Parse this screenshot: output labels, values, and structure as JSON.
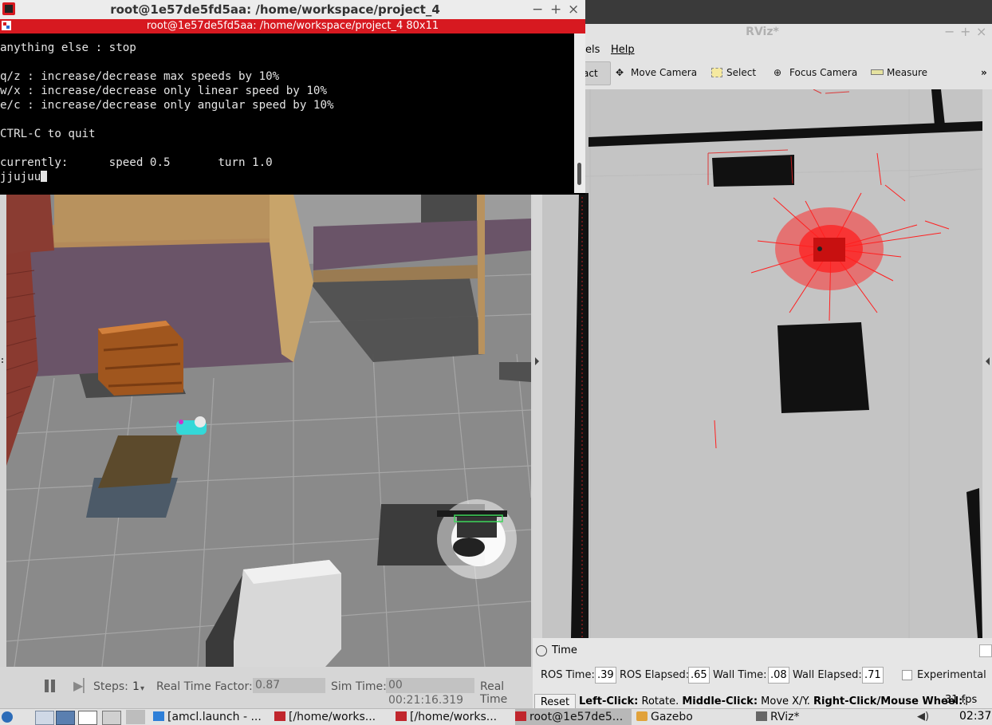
{
  "terminal": {
    "window_title": "root@1e57de5fd5aa: /home/workspace/project_4",
    "tab_title": "root@1e57de5fd5aa: /home/workspace/project_4 80x11",
    "lines": [
      "",
      "anything else : stop",
      "",
      "q/z : increase/decrease max speeds by 10%",
      "w/x : increase/decrease only linear speed by 10%",
      "e/c : increase/decrease only angular speed by 10%",
      "",
      "CTRL-C to quit",
      "",
      "currently:      speed 0.5       turn 1.0",
      "jjujuu"
    ],
    "win_buttons": [
      "−",
      "+",
      "×"
    ]
  },
  "gazebo": {
    "steps_label": "Steps:",
    "steps_value": "1",
    "rtf_label": "Real Time Factor:",
    "rtf_value": "0.87",
    "sim_time_label": "Sim Time:",
    "sim_time_value": "00 00:21:16.319",
    "real_time_label": "Real Time"
  },
  "rviz": {
    "title": "RViz*",
    "win_buttons": [
      "−",
      "+",
      "×"
    ],
    "menu": [
      "els",
      "Help"
    ],
    "tools": [
      "act",
      "Move Camera",
      "Select",
      "Focus Camera",
      "Measure"
    ],
    "tools_more": "»",
    "time_panel": {
      "title": "Time",
      "ros_time_label": "ROS Time:",
      "ros_time_value": ".39",
      "ros_elapsed_label": "ROS Elapsed:",
      "ros_elapsed_value": ".65",
      "wall_time_label": "Wall Time:",
      "wall_time_value": ".08",
      "wall_elapsed_label": "Wall Elapsed:",
      "wall_elapsed_value": ".71",
      "experimental_label": "Experimental",
      "reset_label": "Reset",
      "help_bold_1": "Left-Click:",
      "help_text_1": " Rotate. ",
      "help_bold_2": "Middle-Click:",
      "help_text_2": " Move X/Y. ",
      "help_bold_3": "Right-Click/Mouse Wheel:",
      "help_text_3": ":",
      "fps": "31 fps"
    }
  },
  "taskbar": {
    "items": [
      "[amcl.launch - ...",
      "[/home/works...",
      "[/home/works...",
      "root@1e57de5...",
      "Gazebo",
      "RViz*"
    ],
    "clock": "02:37"
  }
}
